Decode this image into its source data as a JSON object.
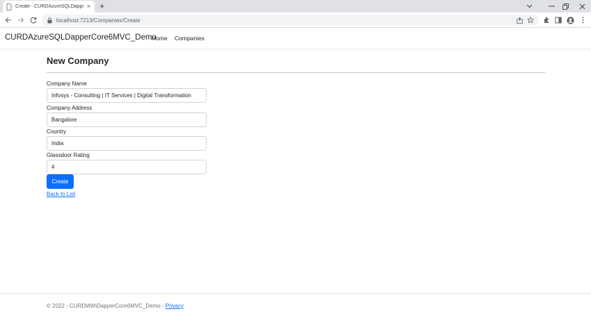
{
  "browser": {
    "tab_title": "Create - CURDAzureSQLDapperC",
    "tab_close": "×",
    "new_tab": "+",
    "url": "localhost:7213/Companies/Create"
  },
  "navbar": {
    "brand": "CURDAzureSQLDapperCore6MVC_Demo",
    "links": [
      "Home",
      "Companies"
    ]
  },
  "form": {
    "title": "New Company",
    "fields": [
      {
        "label": "Company Name",
        "value": "Infosys - Consulting | IT Services | Digital Transformation"
      },
      {
        "label": "Company Address",
        "value": "Bangalore"
      },
      {
        "label": "Country",
        "value": "India"
      },
      {
        "label": "Glassdoor Rating",
        "value": "4"
      }
    ],
    "submit_label": "Create",
    "back_link": "Back to List"
  },
  "footer": {
    "text": "© 2022 - CURDWithDapperCore6MVC_Demo - ",
    "privacy": "Privacy"
  },
  "colors": {
    "primary": "#0d6efd",
    "tabstrip": "#dfe1e5",
    "omnibox": "#f1f3f4"
  }
}
